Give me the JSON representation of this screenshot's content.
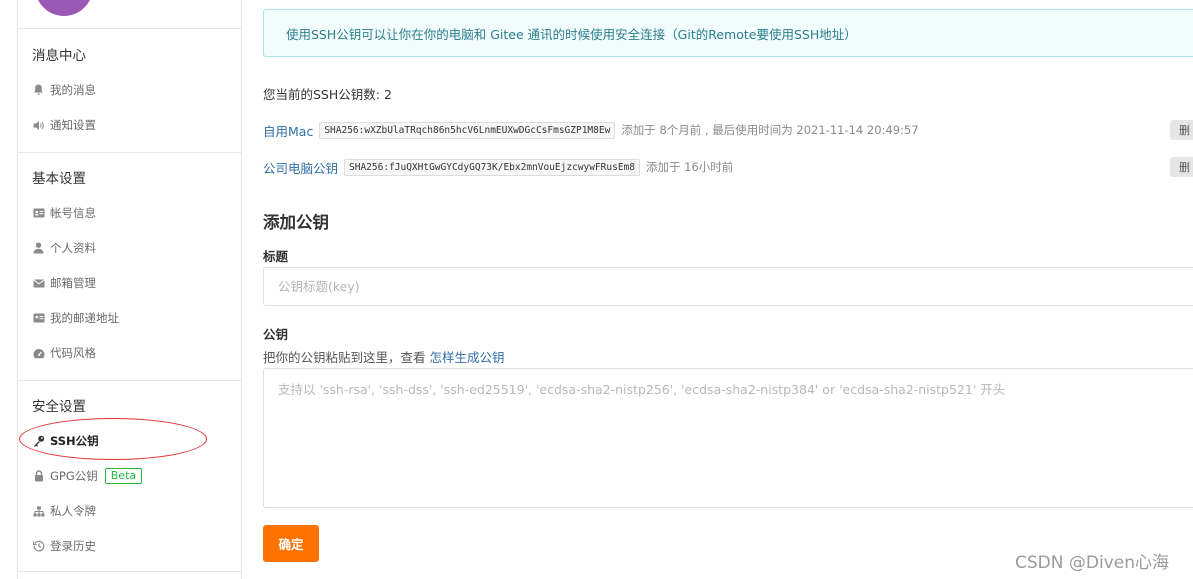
{
  "sidebar": {
    "sections": [
      {
        "title": "消息中心",
        "items": [
          {
            "label": "我的消息",
            "icon": "bell-icon"
          },
          {
            "label": "通知设置",
            "icon": "speaker-icon"
          }
        ]
      },
      {
        "title": "基本设置",
        "items": [
          {
            "label": "帐号信息",
            "icon": "id-card-icon"
          },
          {
            "label": "个人资料",
            "icon": "user-icon"
          },
          {
            "label": "邮箱管理",
            "icon": "mail-icon"
          },
          {
            "label": "我的邮递地址",
            "icon": "address-card-icon"
          },
          {
            "label": "代码风格",
            "icon": "dashboard-icon"
          }
        ]
      },
      {
        "title": "安全设置",
        "items": [
          {
            "label": "SSH公钥",
            "icon": "key-icon",
            "active": true
          },
          {
            "label": "GPG公钥",
            "icon": "lock-icon",
            "badge": "Beta"
          },
          {
            "label": "私人令牌",
            "icon": "sitemap-icon"
          },
          {
            "label": "登录历史",
            "icon": "history-icon"
          }
        ]
      }
    ]
  },
  "main": {
    "info": "使用SSH公钥可以让你在你的电脑和 Gitee 通讯的时候使用安全连接（Git的Remote要使用SSH地址）",
    "count_label": "您当前的SSH公钥数: 2",
    "keys": [
      {
        "name": "自用Mac",
        "fingerprint": "SHA256:wXZbUlaTRqch86n5hcV6LnmEUXwDGcCsFmsGZP1M8Ew",
        "meta": "添加于 8个月前 , 最后使用时间为 2021-11-14 20:49:57",
        "delete_label": "删"
      },
      {
        "name": "公司电脑公钥",
        "fingerprint": "SHA256:fJuQXHtGwGYCdyGQ73K/Ebx2mnVouEjzcwywFRusEm8",
        "meta": "添加于 16小时前",
        "delete_label": "删"
      }
    ],
    "add_heading": "添加公钥",
    "title_label": "标题",
    "title_placeholder": "公钥标题(key)",
    "key_label": "公钥",
    "hint_prefix": "把你的公钥粘贴到这里，查看 ",
    "hint_link": "怎样生成公钥",
    "key_placeholder": "支持以 'ssh-rsa', 'ssh-dss', 'ssh-ed25519', 'ecdsa-sha2-nistp256', 'ecdsa-sha2-nistp384' or 'ecdsa-sha2-nistp521' 开头",
    "confirm_label": "确定"
  },
  "watermark": "CSDN @Diven心海",
  "colors": {
    "accent_orange": "#fe7300",
    "link_blue": "#2f6fa8",
    "info_bg": "#f3fcfd",
    "annotation_red": "#e0332f",
    "beta_green": "#21ba45"
  }
}
